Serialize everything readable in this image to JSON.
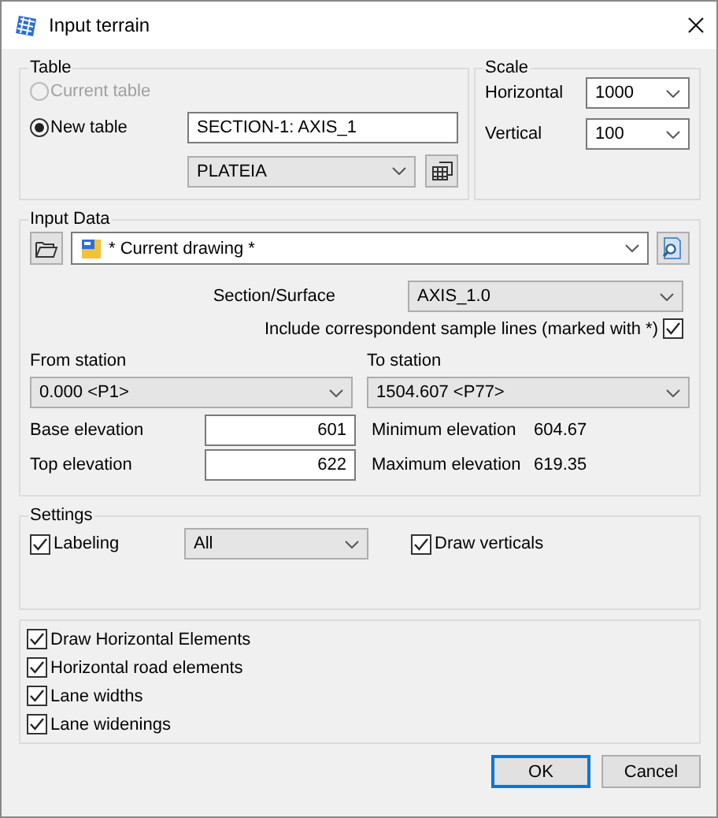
{
  "window": {
    "title": "Input terrain"
  },
  "table": {
    "title": "Table",
    "options": [
      {
        "label": "Current table",
        "selected": false,
        "disabled": true
      },
      {
        "label": "New table",
        "selected": true,
        "disabled": false
      }
    ],
    "name_field": "SECTION-1: AXIS_1",
    "layer_select": "PLATEIA"
  },
  "scale": {
    "title": "Scale",
    "horizontal": {
      "label": "Horizontal",
      "value": "1000"
    },
    "vertical": {
      "label": "Vertical",
      "value": "100"
    }
  },
  "input_data": {
    "title": "Input Data",
    "source": "* Current drawing *",
    "section_label": "Section/Surface",
    "section_value": "AXIS_1.0",
    "include": {
      "label": "Include correspondent sample lines (marked with *)",
      "checked": true
    },
    "from_label": "From station",
    "from_value": "0.000 <P1>",
    "to_label": "To station",
    "to_value": "1504.607 <P77>",
    "base_label": "Base elevation",
    "base_value": "601",
    "top_label": "Top elevation",
    "top_value": "622",
    "min_label": "Minimum elevation",
    "min_value": "604.67",
    "max_label": "Maximum elevation",
    "max_value": "619.35"
  },
  "settings": {
    "title": "Settings",
    "labeling": {
      "label": "Labeling",
      "checked": true
    },
    "labeling_select": "All",
    "draw_verticals": {
      "label": "Draw verticals",
      "checked": true
    }
  },
  "options": [
    {
      "label": "Draw Horizontal Elements",
      "checked": true
    },
    {
      "label": "Horizontal road elements",
      "checked": true
    },
    {
      "label": "Lane widths",
      "checked": true
    },
    {
      "label": "Lane widenings",
      "checked": true
    }
  ],
  "buttons": [
    {
      "label": "OK",
      "default": true
    },
    {
      "label": "Cancel",
      "default": false
    }
  ]
}
